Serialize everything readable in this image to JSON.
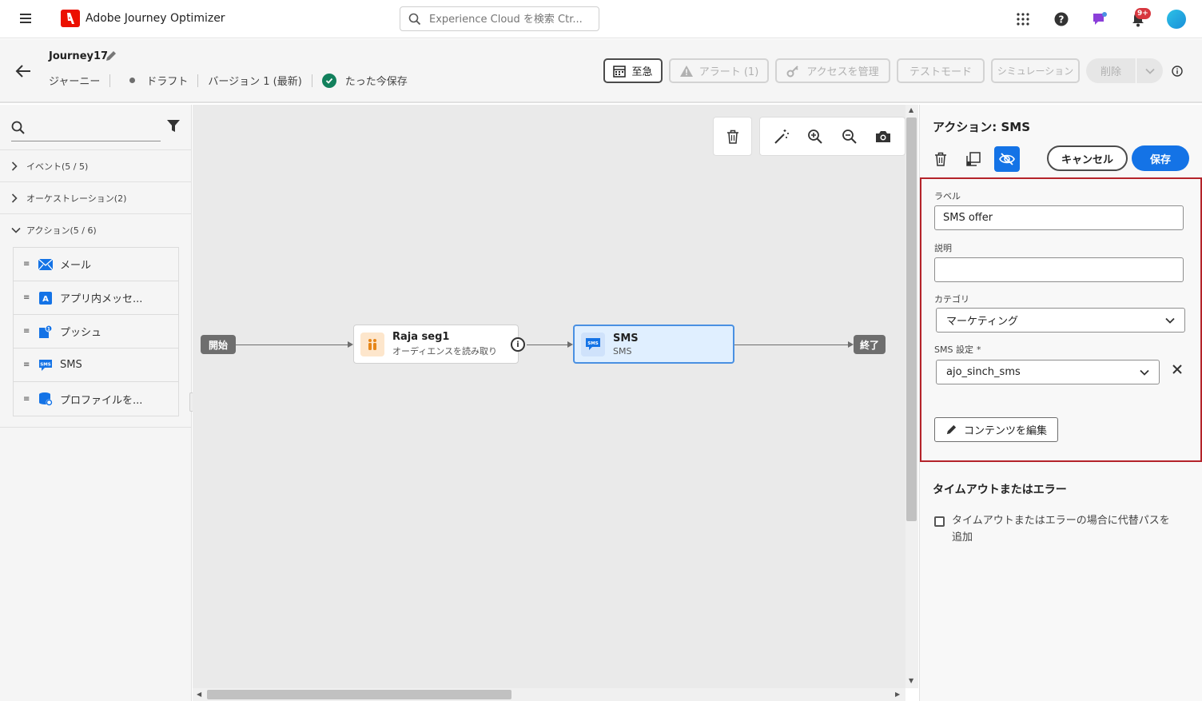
{
  "topbar": {
    "app_title": "Adobe Journey Optimizer",
    "search_placeholder": "Experience Cloud を検索 Ctr...",
    "notification_count": "9+"
  },
  "header": {
    "journey_name": "Journey17",
    "crumb_type": "ジャーニー",
    "status": "ドラフト",
    "version": "バージョン 1 (最新)",
    "saved": "たった今保存",
    "buttons": {
      "schedule": "至急",
      "alert": "アラート (1)",
      "access": "アクセスを管理",
      "test_mode": "テストモード",
      "simulation": "シミュレーション",
      "delete": "削除"
    }
  },
  "palette": {
    "search_placeholder": "",
    "categories": {
      "events": "イベント(5 / 5)",
      "orchestration": "オーケストレーション(2)",
      "actions": "アクション(5 / 6)"
    },
    "actions": [
      {
        "label": "メール",
        "icon": "email-icon"
      },
      {
        "label": "アプリ内メッセ...",
        "icon": "in-app-icon"
      },
      {
        "label": "プッシュ",
        "icon": "push-icon"
      },
      {
        "label": "SMS",
        "icon": "sms-icon"
      },
      {
        "label": "プロファイルを...",
        "icon": "profile-update-icon"
      }
    ]
  },
  "canvas": {
    "start_label": "開始",
    "end_label": "終了",
    "audience_node": {
      "title": "Raja seg1",
      "subtitle": "オーディエンスを読み取り"
    },
    "sms_node": {
      "title": "SMS",
      "subtitle": "SMS",
      "icon_text": "SMS"
    }
  },
  "panel": {
    "title": "アクション: SMS",
    "cancel": "キャンセル",
    "save": "保存",
    "label_label": "ラベル",
    "label_value": "SMS offer",
    "description_label": "説明",
    "description_value": "",
    "category_label": "カテゴリ",
    "category_value": "マーケティング",
    "sms_config_label": "SMS 設定",
    "sms_config_required": "*",
    "sms_config_value": "ajo_sinch_sms",
    "edit_content": "コンテンツを編集",
    "timeout_title": "タイムアウトまたはエラー",
    "timeout_checkbox": "タイムアウトまたはエラーの場合に代替パスを追加"
  },
  "colors": {
    "accent": "#1473e6",
    "adobe_red": "#eb1000",
    "selected_border": "#b4232a"
  }
}
